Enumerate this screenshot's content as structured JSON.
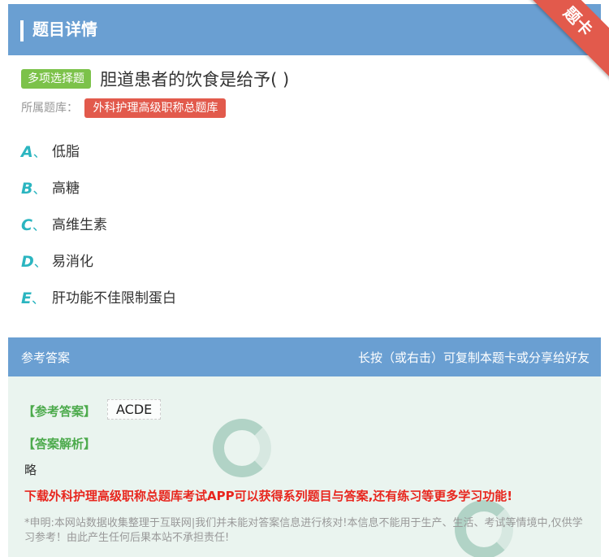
{
  "header": {
    "title": "题目详情",
    "corner_badge": "题卡"
  },
  "question": {
    "type_tag": "多项选择题",
    "text": "胆道患者的饮食是给予( )",
    "bank_label": "所属题库：",
    "bank_name": "外科护理高级职称总题库"
  },
  "options": [
    {
      "letter": "A",
      "sep": "、",
      "text": "低脂"
    },
    {
      "letter": "B",
      "sep": "、",
      "text": "高糖"
    },
    {
      "letter": "C",
      "sep": "、",
      "text": "高维生素"
    },
    {
      "letter": "D",
      "sep": "、",
      "text": "易消化"
    },
    {
      "letter": "E",
      "sep": "、",
      "text": "肝功能不佳限制蛋白"
    }
  ],
  "answer_panel": {
    "title": "参考答案",
    "hint": "长按（或右击）可复制本题卡或分享给好友",
    "answer_label": "【参考答案】",
    "answer_value": "ACDE",
    "explanation_label": "【答案解析】",
    "explanation_value": "略",
    "promo": "下载外科护理高级职称总题库考试APP可以获得系列题目与答案,还有练习等更多学习功能!",
    "disclaimer": "*申明:本网站数据收集整理于互联网|我们并未能对答案信息进行核对!本信息不能用于生产、生活、考试等情境中,仅供学习参考！由此产生任何后果本站不承担责任!"
  },
  "colors": {
    "header_bg": "#6a9fd2",
    "type_tag_bg": "#7cc24a",
    "bank_tag_bg": "#e25a4c",
    "option_letter": "#2bb5c0",
    "answer_label": "#4caa4c",
    "promo_text": "#e8261e",
    "answer_panel_bg": "#eaf4ef"
  }
}
